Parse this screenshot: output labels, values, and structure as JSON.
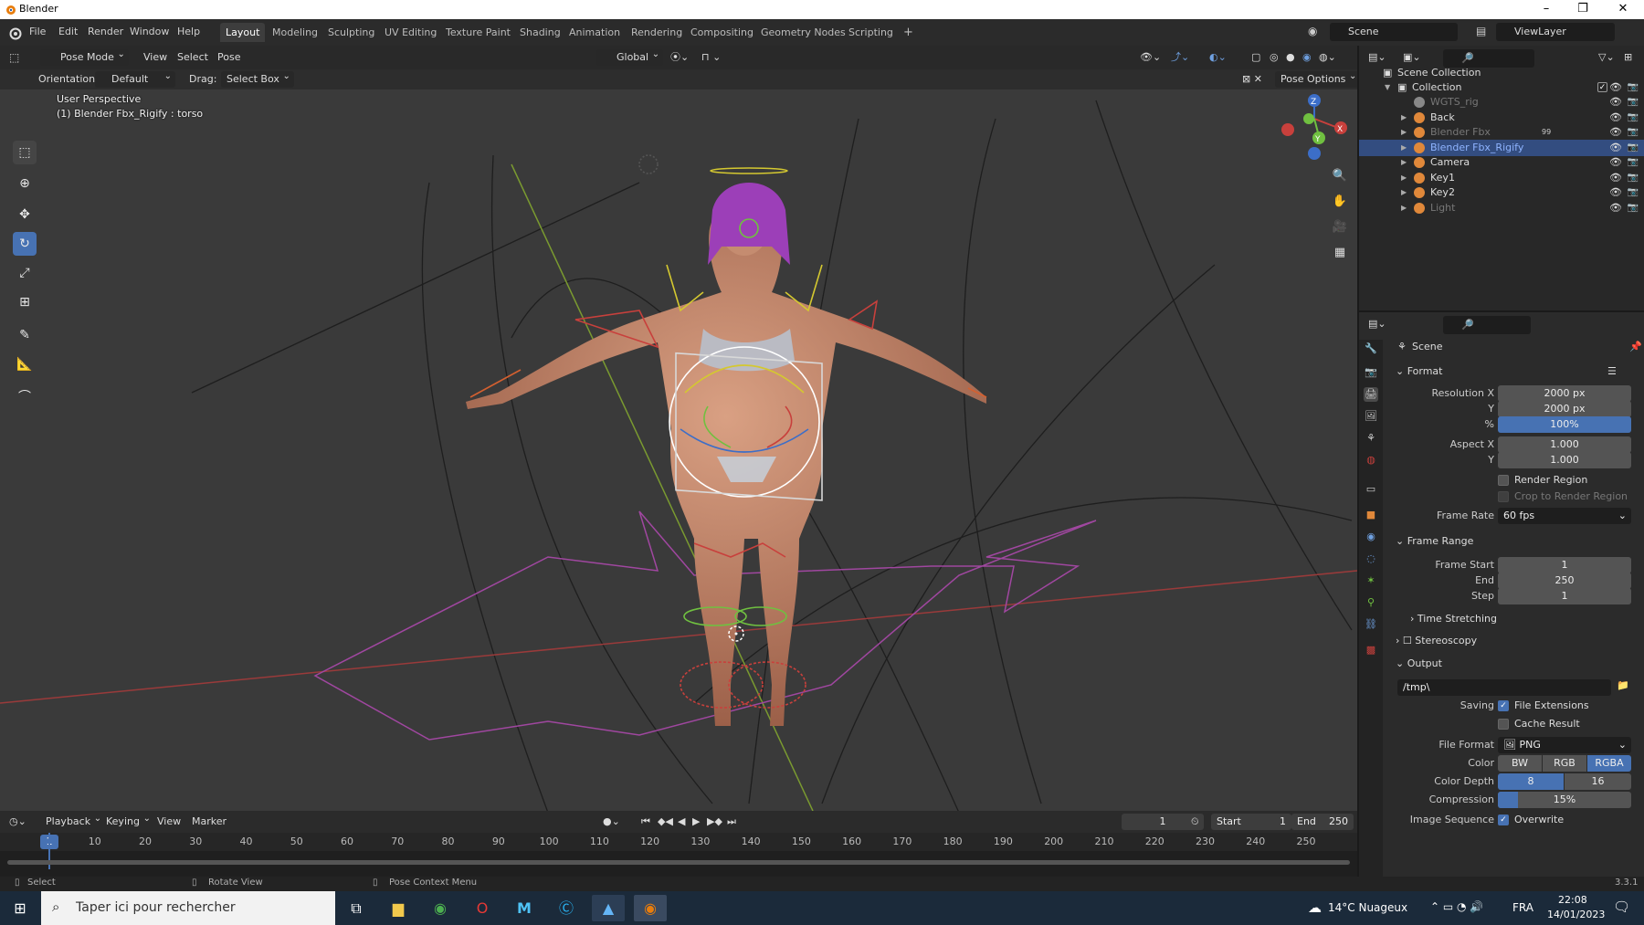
{
  "window": {
    "title": "Blender",
    "controls": [
      "–",
      "❐",
      "✕"
    ]
  },
  "menu": [
    "File",
    "Edit",
    "Render",
    "Window",
    "Help"
  ],
  "workspaces": [
    "Layout",
    "Modeling",
    "Sculpting",
    "UV Editing",
    "Texture Paint",
    "Shading",
    "Animation",
    "Rendering",
    "Compositing",
    "Geometry Nodes",
    "Scripting"
  ],
  "active_workspace": "Layout",
  "add_tab": "+",
  "scene_field": "Scene",
  "viewlayer_field": "ViewLayer",
  "viewport": {
    "mode": "Pose Mode",
    "menu": [
      "View",
      "Select",
      "Pose"
    ],
    "transform": "Global",
    "orientation_label": "Orientation:",
    "orientation_value": "Default",
    "drag_label": "Drag:",
    "drag_value": "Select Box",
    "pose_options": "Pose Options",
    "perspective": "User Perspective",
    "active_object": "(1) Blender Fbx_Rigify : torso"
  },
  "outliner": {
    "root": "Scene Collection",
    "collection": "Collection",
    "items": [
      {
        "name": "WGTS_rig",
        "dim": true,
        "color": "#888888"
      },
      {
        "name": "Back",
        "dim": false,
        "color": "#e0883a"
      },
      {
        "name": "Blender Fbx",
        "dim": true,
        "color": "#e0883a",
        "badge": "99"
      },
      {
        "name": "Blender Fbx_Rigify",
        "dim": false,
        "color": "#e0883a",
        "selected": true
      },
      {
        "name": "Camera",
        "dim": false,
        "color": "#e0883a"
      },
      {
        "name": "Key1",
        "dim": false,
        "color": "#e0883a"
      },
      {
        "name": "Key2",
        "dim": false,
        "color": "#e0883a"
      },
      {
        "name": "Light",
        "dim": true,
        "color": "#e0883a"
      }
    ]
  },
  "properties": {
    "context": "Scene",
    "format_title": "Format",
    "res_x_label": "Resolution X",
    "res_x": "2000 px",
    "res_y_label": "Y",
    "res_y": "2000 px",
    "res_pct_label": "%",
    "res_pct": "100%",
    "aspect_x_label": "Aspect X",
    "aspect_x": "1.000",
    "aspect_y_label": "Y",
    "aspect_y": "1.000",
    "render_region": "Render Region",
    "crop_region": "Crop to Render Region",
    "frame_rate_label": "Frame Rate",
    "frame_rate": "60 fps",
    "frame_range_title": "Frame Range",
    "frame_start_label": "Frame Start",
    "frame_start": "1",
    "end_label": "End",
    "end": "250",
    "step_label": "Step",
    "step": "1",
    "time_stretching": "Time Stretching",
    "stereoscopy": "Stereoscopy",
    "output_title": "Output",
    "output_path": "/tmp\\",
    "saving_label": "Saving",
    "file_extensions": "File Extensions",
    "cache_result": "Cache Result",
    "file_format_label": "File Format",
    "file_format": "PNG",
    "color_label": "Color",
    "color_bw": "BW",
    "color_rgb": "RGB",
    "color_rgba": "RGBA",
    "depth_label": "Color Depth",
    "depth_8": "8",
    "depth_16": "16",
    "compression_label": "Compression",
    "compression": "15%",
    "compression_value": 0.15,
    "image_seq_label": "Image Sequence",
    "overwrite": "Overwrite"
  },
  "timeline": {
    "menu": [
      "Playback",
      "Keying",
      "View",
      "Marker"
    ],
    "current_frame": "1",
    "start_label": "Start",
    "start": "1",
    "end_label": "End",
    "end": "250",
    "ticks": [
      "1",
      "10",
      "20",
      "30",
      "40",
      "50",
      "60",
      "70",
      "80",
      "90",
      "100",
      "110",
      "120",
      "130",
      "140",
      "150",
      "160",
      "170",
      "180",
      "190",
      "200",
      "210",
      "220",
      "230",
      "240",
      "250"
    ]
  },
  "status": {
    "select": "Select",
    "rotate": "Rotate View",
    "pose_menu": "Pose Context Menu",
    "version": "3.3.1"
  },
  "taskbar": {
    "search_placeholder": "Taper ici pour rechercher",
    "weather": "14°C  Nuageux",
    "lang": "FRA",
    "time": "22:08",
    "date": "14/01/2023"
  },
  "colors": {
    "accent": "#4772b3",
    "selection": "#334d80",
    "x_axis": "#c8403c",
    "y_axis": "#8ab23c",
    "z_axis": "#3c6ec8"
  }
}
